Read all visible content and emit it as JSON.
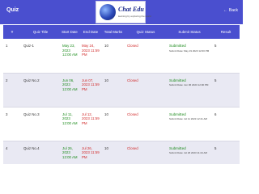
{
  "header": {
    "title": "Quiz",
    "back_label": "Back",
    "logo_name": "Chat Edu",
    "logo_tagline": "learning by exploring the world"
  },
  "table": {
    "columns": [
      "#",
      "Quiz Title",
      "Start Date",
      "End Date",
      "Total Marks",
      "Quiz Status",
      "Submit Status",
      "Result"
    ],
    "rows": [
      {
        "num": "1",
        "title": "Quiz-1",
        "start": "May 23, 2023 12:00 AM",
        "end": "May 24, 2023 11:59 PM",
        "marks": "10",
        "status": "Closed",
        "submit": "Submitted",
        "submit_date": "Submit Date: May 19 2023 12:00 PM",
        "result": "5"
      },
      {
        "num": "2",
        "title": "Quiz No.2",
        "start": "Jun 06, 2023 12:00 AM",
        "end": "Jun 07, 2023 11:59 PM",
        "marks": "10",
        "status": "Closed",
        "submit": "Submitted",
        "submit_date": "Submit Date: Jun 06 2023 12:00 PM",
        "result": "5"
      },
      {
        "num": "3",
        "title": "Quiz No.3",
        "start": "Jul 11, 2023 12:00 AM",
        "end": "Jul 12, 2023 11:59 PM",
        "marks": "10",
        "status": "Closed",
        "submit": "Submitted",
        "submit_date": "Submit Date: Jul 11 2023 12:41 AM",
        "result": "6"
      },
      {
        "num": "4",
        "title": "Quiz No.4",
        "start": "Jul 26, 2023 12:00 AM",
        "end": "Jul 26, 2023 11:59 PM",
        "marks": "10",
        "status": "Closed",
        "submit": "Submitted",
        "submit_date": "Submit Date: Jul 26 2023 11:24 AM",
        "result": "5"
      }
    ]
  }
}
